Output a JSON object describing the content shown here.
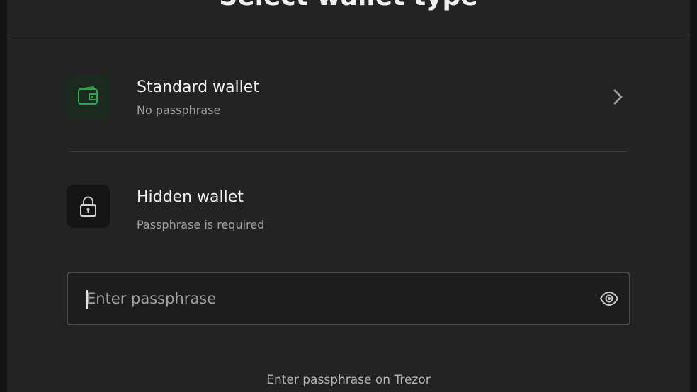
{
  "modal": {
    "title": "Select wallet type"
  },
  "options": [
    {
      "title": "Standard wallet",
      "subtitle": "No passphrase",
      "icon": "wallet-icon",
      "accent": "#2ea44f"
    },
    {
      "title": "Hidden wallet",
      "subtitle": "Passphrase is required",
      "icon": "lock-icon"
    }
  ],
  "passphrase": {
    "placeholder": "Enter passphrase",
    "value": "",
    "toggle_icon": "eye-icon"
  },
  "links": {
    "enter_on_device": "Enter passphrase on Trezor"
  },
  "colors": {
    "background": "#232324",
    "accent_green": "#2ea44f"
  }
}
